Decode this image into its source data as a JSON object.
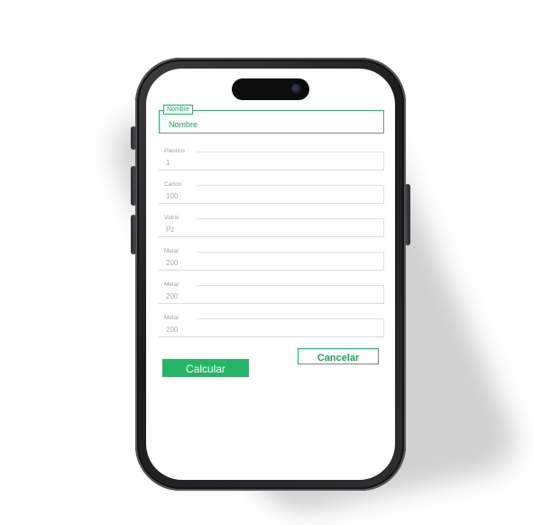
{
  "form": {
    "name_legend": "Nombre",
    "name_value": "Nombre",
    "fields": [
      {
        "label": "Plastico",
        "value": "1"
      },
      {
        "label": "Carton",
        "value": "100"
      },
      {
        "label": "Vidrio",
        "value": "Pz"
      },
      {
        "label": "Metal",
        "value": "200"
      },
      {
        "label": "Metal",
        "value": "200"
      },
      {
        "label": "Metal",
        "value": "200"
      }
    ]
  },
  "actions": {
    "calculate_label": "Calcular",
    "cancel_label": "Cancelar"
  },
  "colors": {
    "accent": "#26b566",
    "phone_frame": "#1b1c1d",
    "field_border": "#d9dbdd"
  }
}
